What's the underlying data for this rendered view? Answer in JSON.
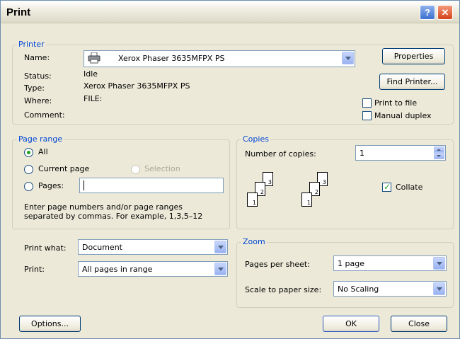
{
  "window": {
    "title": "Print"
  },
  "printer": {
    "group_label": "Printer",
    "name_label": "Name:",
    "name_value": "Xerox Phaser 3635MFPX PS",
    "status_label": "Status:",
    "status_value": "Idle",
    "type_label": "Type:",
    "type_value": "Xerox Phaser 3635MFPX PS",
    "where_label": "Where:",
    "where_value": "FILE:",
    "comment_label": "Comment:",
    "properties_button": "Properties",
    "find_printer_button": "Find Printer...",
    "print_to_file_label": "Print to file",
    "print_to_file_checked": false,
    "manual_duplex_label": "Manual duplex",
    "manual_duplex_checked": false
  },
  "page_range": {
    "group_label": "Page range",
    "all_label": "All",
    "current_page_label": "Current page",
    "selection_label": "Selection",
    "pages_label": "Pages:",
    "pages_value": "",
    "selected": "All",
    "hint_line1": "Enter page numbers and/or page ranges",
    "hint_line2": "separated by commas.  For example, 1,3,5–12"
  },
  "copies": {
    "group_label": "Copies",
    "number_label": "Number of copies:",
    "number_value": "1",
    "collate_label": "Collate",
    "collate_checked": true,
    "stack1_pages": [
      "3",
      "2",
      "1"
    ],
    "stack2_pages": [
      "3",
      "2",
      "1"
    ]
  },
  "print_what": {
    "print_what_label": "Print what:",
    "print_what_value": "Document",
    "print_label": "Print:",
    "print_value": "All pages in range"
  },
  "zoom": {
    "group_label": "Zoom",
    "pages_per_sheet_label": "Pages per sheet:",
    "pages_per_sheet_value": "1 page",
    "scale_label": "Scale to paper size:",
    "scale_value": "No Scaling"
  },
  "footer": {
    "options_button": "Options...",
    "ok_button": "OK",
    "close_button": "Close"
  },
  "colors": {
    "group_label": "#0046d5",
    "background": "#ece9d8",
    "check_mark": "#21a121"
  },
  "icons": {
    "help": "help-icon",
    "close": "close-icon",
    "printer": "printer-icon"
  }
}
